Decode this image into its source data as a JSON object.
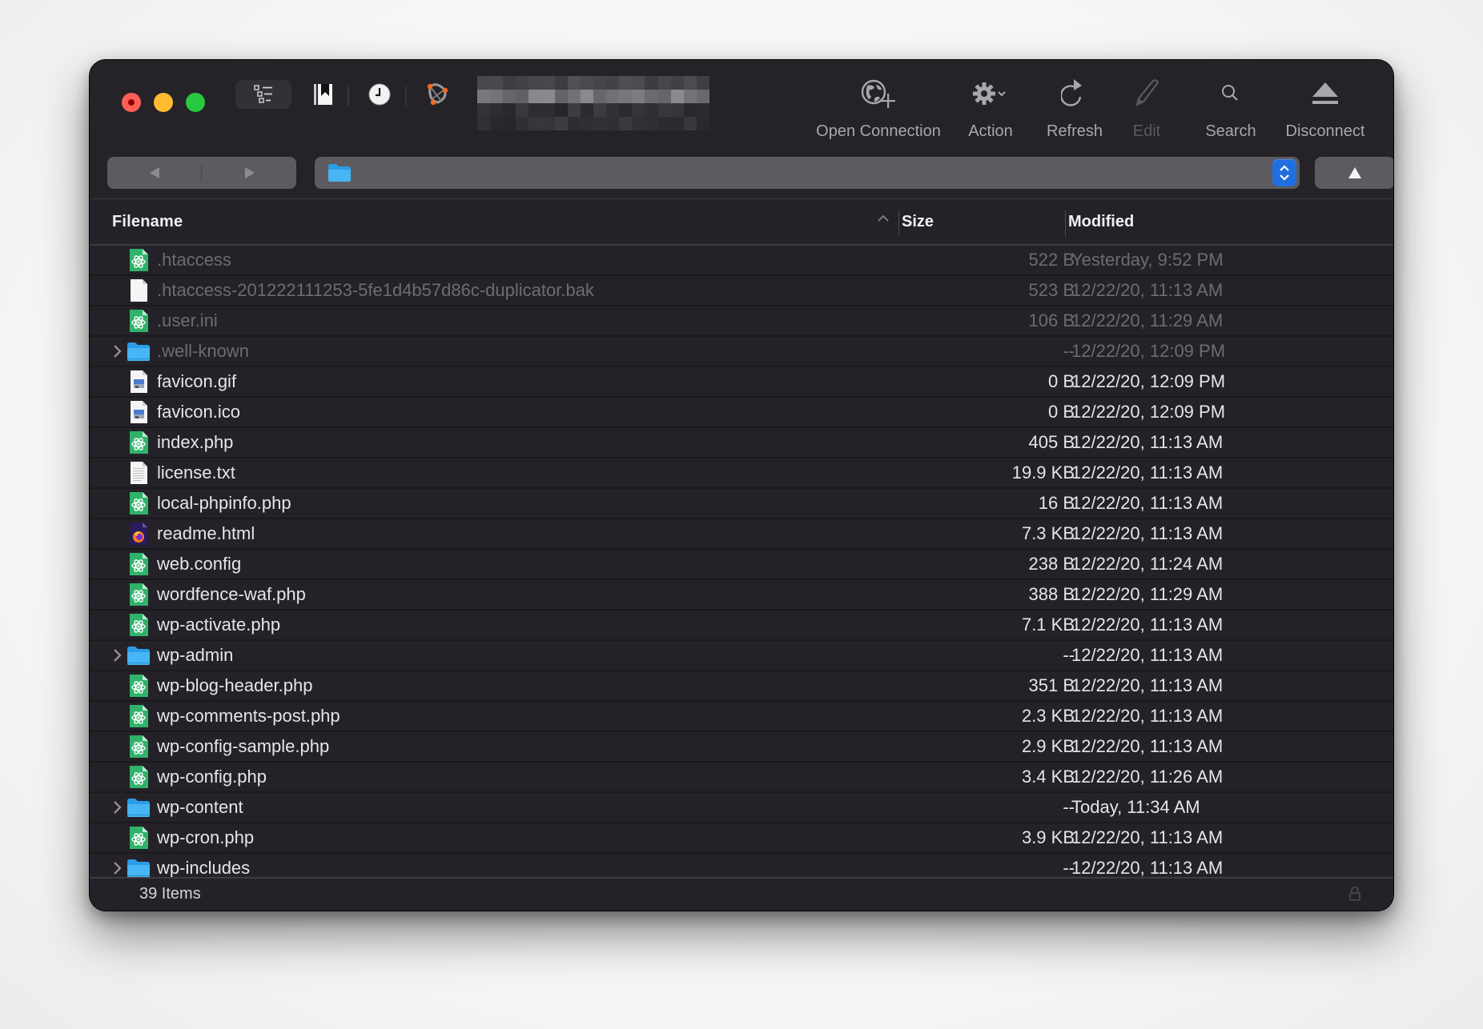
{
  "window": {
    "traffic_lights": [
      "close",
      "minimize",
      "zoom"
    ],
    "title_redacted": true
  },
  "toolbar": {
    "left_icons": [
      "outline-view-icon",
      "bookmarks-icon",
      "history-icon",
      "bonjour-icon"
    ],
    "items": [
      {
        "id": "open-connection",
        "label": "Open Connection",
        "icon": "globe-plus-icon",
        "enabled": true
      },
      {
        "id": "action",
        "label": "Action",
        "icon": "gear-icon",
        "enabled": true
      },
      {
        "id": "refresh",
        "label": "Refresh",
        "icon": "refresh-icon",
        "enabled": true
      },
      {
        "id": "edit",
        "label": "Edit",
        "icon": "pencil-icon",
        "enabled": false
      },
      {
        "id": "search",
        "label": "Search",
        "icon": "search-icon",
        "enabled": true
      },
      {
        "id": "disconnect",
        "label": "Disconnect",
        "icon": "eject-icon",
        "enabled": true
      }
    ]
  },
  "navigation": {
    "back_icon": "back-triangle-icon",
    "forward_icon": "forward-triangle-icon",
    "path_redacted": true,
    "up_icon": "up-triangle-icon"
  },
  "columns": {
    "filename": "Filename",
    "size": "Size",
    "modified": "Modified",
    "sort_indicator": "ascending"
  },
  "colors": {
    "window_bg": "#242228",
    "folder_blue": "#36aef0",
    "php_green": "#2fb36a",
    "stepper_blue": "#1f6fe0",
    "hidden_text": "#6e6c71",
    "text": "#e6e5e8"
  },
  "files": [
    {
      "name": ".htaccess",
      "size": "522 B",
      "modified": "Yesterday, 9:52 PM",
      "type": "php",
      "hidden": true,
      "folder": false
    },
    {
      "name": ".htaccess-201222111253-5fe1d4b57d86c-duplicator.bak",
      "size": "523 B",
      "modified": "12/22/20, 11:13 AM",
      "type": "blank",
      "hidden": true,
      "folder": false
    },
    {
      "name": ".user.ini",
      "size": "106 B",
      "modified": "12/22/20, 11:29 AM",
      "type": "php",
      "hidden": true,
      "folder": false
    },
    {
      "name": ".well-known",
      "size": "--",
      "modified": "12/22/20, 12:09 PM",
      "type": "folder",
      "hidden": true,
      "folder": true
    },
    {
      "name": "favicon.gif",
      "size": "0 B",
      "modified": "12/22/20, 12:09 PM",
      "type": "image",
      "hidden": false,
      "folder": false
    },
    {
      "name": "favicon.ico",
      "size": "0 B",
      "modified": "12/22/20, 12:09 PM",
      "type": "image",
      "hidden": false,
      "folder": false
    },
    {
      "name": "index.php",
      "size": "405 B",
      "modified": "12/22/20, 11:13 AM",
      "type": "php",
      "hidden": false,
      "folder": false
    },
    {
      "name": "license.txt",
      "size": "19.9 KB",
      "modified": "12/22/20, 11:13 AM",
      "type": "text",
      "hidden": false,
      "folder": false
    },
    {
      "name": "local-phpinfo.php",
      "size": "16 B",
      "modified": "12/22/20, 11:13 AM",
      "type": "php",
      "hidden": false,
      "folder": false
    },
    {
      "name": "readme.html",
      "size": "7.3 KB",
      "modified": "12/22/20, 11:13 AM",
      "type": "html",
      "hidden": false,
      "folder": false
    },
    {
      "name": "web.config",
      "size": "238 B",
      "modified": "12/22/20, 11:24 AM",
      "type": "php",
      "hidden": false,
      "folder": false
    },
    {
      "name": "wordfence-waf.php",
      "size": "388 B",
      "modified": "12/22/20, 11:29 AM",
      "type": "php",
      "hidden": false,
      "folder": false
    },
    {
      "name": "wp-activate.php",
      "size": "7.1 KB",
      "modified": "12/22/20, 11:13 AM",
      "type": "php",
      "hidden": false,
      "folder": false
    },
    {
      "name": "wp-admin",
      "size": "--",
      "modified": "12/22/20, 11:13 AM",
      "type": "folder",
      "hidden": false,
      "folder": true
    },
    {
      "name": "wp-blog-header.php",
      "size": "351 B",
      "modified": "12/22/20, 11:13 AM",
      "type": "php",
      "hidden": false,
      "folder": false
    },
    {
      "name": "wp-comments-post.php",
      "size": "2.3 KB",
      "modified": "12/22/20, 11:13 AM",
      "type": "php",
      "hidden": false,
      "folder": false
    },
    {
      "name": "wp-config-sample.php",
      "size": "2.9 KB",
      "modified": "12/22/20, 11:13 AM",
      "type": "php",
      "hidden": false,
      "folder": false
    },
    {
      "name": "wp-config.php",
      "size": "3.4 KB",
      "modified": "12/22/20, 11:26 AM",
      "type": "php",
      "hidden": false,
      "folder": false
    },
    {
      "name": "wp-content",
      "size": "--",
      "modified": "Today, 11:34 AM",
      "type": "folder",
      "hidden": false,
      "folder": true
    },
    {
      "name": "wp-cron.php",
      "size": "3.9 KB",
      "modified": "12/22/20, 11:13 AM",
      "type": "php",
      "hidden": false,
      "folder": false
    },
    {
      "name": "wp-includes",
      "size": "--",
      "modified": "12/22/20, 11:13 AM",
      "type": "folder",
      "hidden": false,
      "folder": true
    }
  ],
  "status": {
    "item_count": "39 Items",
    "lock_icon": "lock-icon"
  }
}
